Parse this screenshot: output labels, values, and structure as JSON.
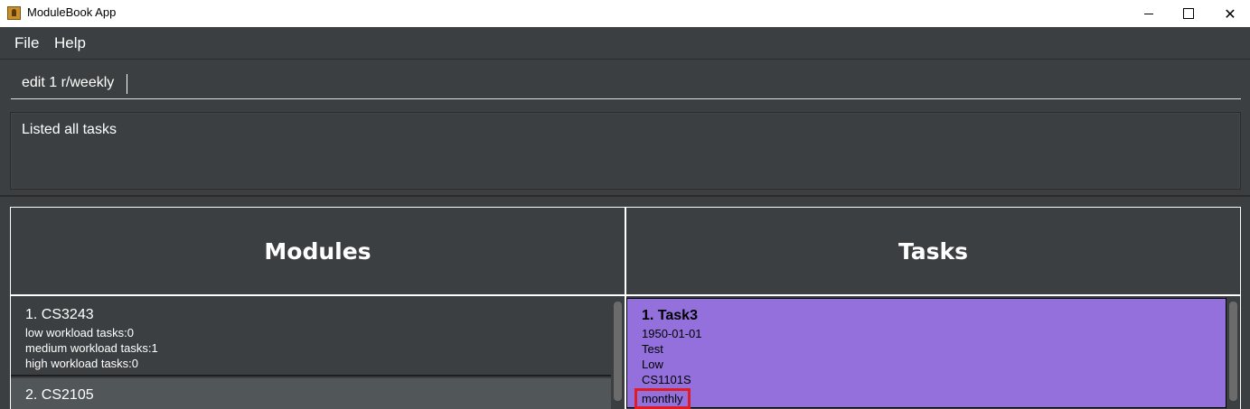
{
  "window": {
    "title": "ModuleBook App",
    "icons": {
      "minimize": "minimize-icon",
      "maximize": "maximize-icon",
      "close": "close-icon"
    },
    "close_glyph": "✕"
  },
  "menu": {
    "file": "File",
    "help": "Help"
  },
  "command": {
    "value": "edit 1 r/weekly"
  },
  "result": {
    "text": "Listed all tasks"
  },
  "modules": {
    "header": "Modules",
    "items": [
      {
        "title": "1.  CS3243",
        "lines": [
          "low workload tasks:0",
          "medium workload tasks:1",
          "high workload tasks:0"
        ]
      },
      {
        "title": "2.  CS2105"
      }
    ]
  },
  "tasks": {
    "header": "Tasks",
    "items": [
      {
        "title": "1.  Task3",
        "date": "1950-01-01",
        "description": "Test",
        "workload": "Low",
        "module": "CS1101S",
        "recurrence": "monthly"
      }
    ]
  },
  "colors": {
    "background": "#3c3f41",
    "selected_task": "#9370db",
    "highlight": "#e01b24"
  }
}
